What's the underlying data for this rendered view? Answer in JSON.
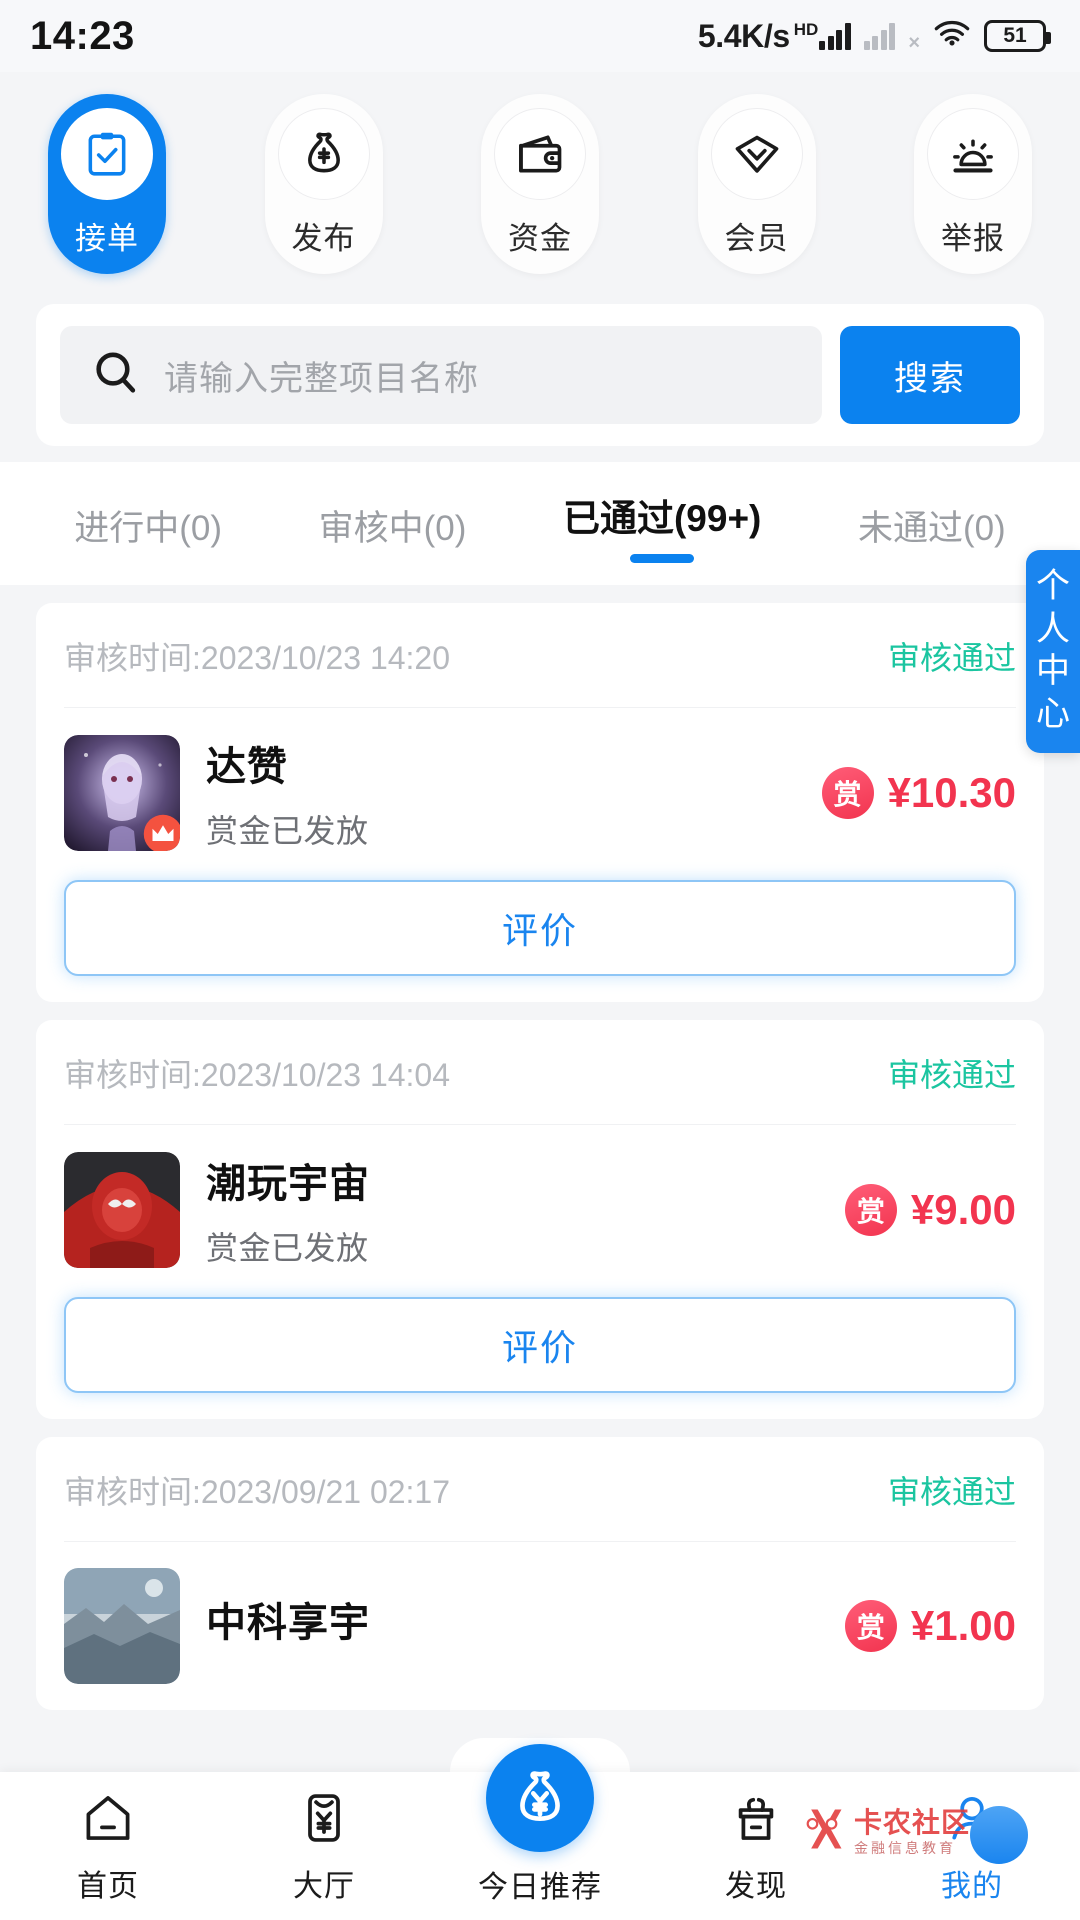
{
  "status_bar": {
    "time": "14:23",
    "network_speed": "5.4K/s",
    "hd_label": "HD",
    "battery_level": "51"
  },
  "top_nav": {
    "items": [
      {
        "label": "接单",
        "icon": "clipboard-check-icon",
        "active": true
      },
      {
        "label": "发布",
        "icon": "money-bag-icon",
        "active": false
      },
      {
        "label": "资金",
        "icon": "wallet-icon",
        "active": false
      },
      {
        "label": "会员",
        "icon": "diamond-icon",
        "active": false
      },
      {
        "label": "举报",
        "icon": "alarm-siren-icon",
        "active": false
      }
    ]
  },
  "search": {
    "placeholder": "请输入完整项目名称",
    "value": "",
    "button_label": "搜索",
    "icon": "search-icon"
  },
  "filter_tabs": [
    {
      "label": "进行中(0)",
      "active": false
    },
    {
      "label": "审核中(0)",
      "active": false
    },
    {
      "label": "已通过(99+)",
      "active": true
    },
    {
      "label": "未通过(0)",
      "active": false
    }
  ],
  "side_tab": {
    "label": "个人中心",
    "chars": [
      "个",
      "人",
      "中",
      "心"
    ]
  },
  "orders": [
    {
      "time_label": "审核时间:2023/10/23 14:20",
      "status": "审核通过",
      "title": "达赞",
      "subtitle": "赏金已发放",
      "reward_badge": "赏",
      "price": "¥10.30",
      "action_label": "评价",
      "thumb_colors": [
        "#3b2a52",
        "#8a7bb0",
        "#d8cfe8"
      ]
    },
    {
      "time_label": "审核时间:2023/10/23 14:04",
      "status": "审核通过",
      "title": "潮玩宇宙",
      "subtitle": "赏金已发放",
      "reward_badge": "赏",
      "price": "¥9.00",
      "action_label": "评价",
      "thumb_colors": [
        "#6e1a1a",
        "#c42b2b",
        "#2a2a2a"
      ]
    },
    {
      "time_label": "审核时间:2023/09/21 02:17",
      "status": "审核通过",
      "title": "中科享宇",
      "subtitle": "",
      "reward_badge": "赏",
      "price": "¥1.00",
      "action_label": "",
      "thumb_colors": [
        "#8d9aa8",
        "#cfd6dc",
        "#6b7d8c"
      ]
    }
  ],
  "bottom_nav": [
    {
      "label": "首页",
      "icon": "home-icon",
      "active": false
    },
    {
      "label": "大厅",
      "icon": "hall-yen-icon",
      "active": false
    },
    {
      "label": "今日推荐",
      "icon": "money-bag-fab-icon",
      "active": false
    },
    {
      "label": "发现",
      "icon": "basket-icon",
      "active": false
    },
    {
      "label": "我的",
      "icon": "profile-icon",
      "active": true
    }
  ],
  "watermark": {
    "main": "卡农社区",
    "sub": "金融信息教育"
  },
  "colors": {
    "accent": "#0b82ef",
    "success": "#1bc5a0",
    "price": "#f2344f",
    "page_bg": "#f4f5f7"
  }
}
